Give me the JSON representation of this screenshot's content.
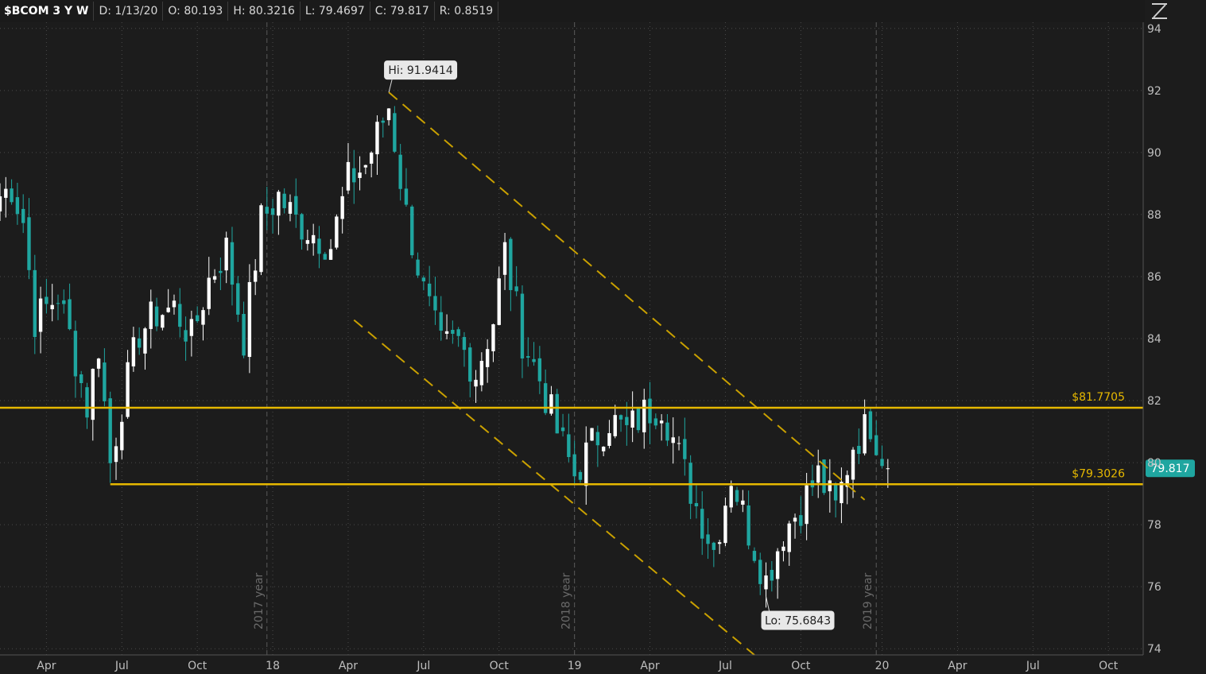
{
  "header": {
    "symbol": "$BCOM 3 Y W",
    "date": "D: 1/13/20",
    "open": "O: 80.193",
    "high": "H: 80.3216",
    "low": "L: 79.4697",
    "close": "C: 79.817",
    "range": "R: 0.8519"
  },
  "icons": {
    "alert": "alert-icon",
    "drawing": "drawing-tools-icon"
  },
  "colors": {
    "background": "#1c1c1c",
    "up_candle": "#ffffff",
    "down_candle": "#1fa6a0",
    "support_resistance": "#e6b800",
    "channel": "#c9a000",
    "grid": "#4a4a4a",
    "price_badge": "#1fa6a0"
  },
  "chart_data": {
    "type": "candlestick",
    "title": "$BCOM 3 Y W",
    "ylim": [
      73.8,
      94.2
    ],
    "y_ticks": [
      74,
      76,
      78,
      80,
      82,
      84,
      86,
      88,
      90,
      92,
      94
    ],
    "x_range": [
      "2017-02-06",
      "2020-11-16"
    ],
    "x_ticks": [
      {
        "label": "Apr",
        "date": "2017-04-03"
      },
      {
        "label": "Jul",
        "date": "2017-07-03"
      },
      {
        "label": "Oct",
        "date": "2017-10-02"
      },
      {
        "label": "18",
        "date": "2018-01-01"
      },
      {
        "label": "Apr",
        "date": "2018-04-02"
      },
      {
        "label": "Jul",
        "date": "2018-07-02"
      },
      {
        "label": "Oct",
        "date": "2018-10-01"
      },
      {
        "label": "19",
        "date": "2018-12-31"
      },
      {
        "label": "Apr",
        "date": "2019-04-01"
      },
      {
        "label": "Jul",
        "date": "2019-07-01"
      },
      {
        "label": "Oct",
        "date": "2019-09-30"
      },
      {
        "label": "20",
        "date": "2020-01-06"
      },
      {
        "label": "Apr",
        "date": "2020-04-06"
      },
      {
        "label": "Jul",
        "date": "2020-07-06"
      },
      {
        "label": "Oct",
        "date": "2020-10-05"
      }
    ],
    "year_markers": [
      {
        "label": "2017 year",
        "date": "2017-12-25"
      },
      {
        "label": "2018 year",
        "date": "2018-12-31"
      },
      {
        "label": "2019 year",
        "date": "2019-12-30"
      }
    ],
    "annotations": [
      {
        "label": "Hi: 91.9414",
        "date": "2018-05-21",
        "value": 91.9414
      },
      {
        "label": "Lo: 75.6843",
        "date": "2019-08-19",
        "value": 75.6843
      }
    ],
    "horizontal_lines": [
      {
        "label": "$81.7705",
        "value": 81.7705,
        "start": "2017-02-06"
      },
      {
        "label": "$79.3026",
        "value": 79.3026,
        "start": "2017-06-19"
      }
    ],
    "channel_lines": [
      {
        "from": {
          "date": "2018-05-21",
          "value": 91.9414
        },
        "to": {
          "date": "2019-12-16",
          "value": 78.8
        }
      },
      {
        "from": {
          "date": "2018-04-09",
          "value": 84.6
        },
        "to": {
          "date": "2019-08-05",
          "value": 73.8
        }
      }
    ],
    "last_price": {
      "label": "79.817",
      "value": 79.817
    },
    "anchors": [
      [
        "2017-02-06",
        88.6
      ],
      [
        "2017-02-20",
        88.9
      ],
      [
        "2017-03-06",
        87.8
      ],
      [
        "2017-03-20",
        84.6
      ],
      [
        "2017-04-03",
        85.0
      ],
      [
        "2017-04-17",
        85.4
      ],
      [
        "2017-05-01",
        84.1
      ],
      [
        "2017-05-22",
        81.8
      ],
      [
        "2017-06-05",
        83.8
      ],
      [
        "2017-06-19",
        80.0
      ],
      [
        "2017-07-03",
        81.9
      ],
      [
        "2017-07-24",
        84.2
      ],
      [
        "2017-08-14",
        84.8
      ],
      [
        "2017-09-04",
        85.0
      ],
      [
        "2017-09-25",
        84.0
      ],
      [
        "2017-10-16",
        85.9
      ],
      [
        "2017-11-06",
        86.9
      ],
      [
        "2017-11-27",
        84.0
      ],
      [
        "2017-12-18",
        87.8
      ],
      [
        "2018-01-08",
        88.6
      ],
      [
        "2018-01-29",
        87.8
      ],
      [
        "2018-02-19",
        87.4
      ],
      [
        "2018-03-12",
        87.0
      ],
      [
        "2018-04-02",
        89.1
      ],
      [
        "2018-04-23",
        89.6
      ],
      [
        "2018-05-21",
        91.5
      ],
      [
        "2018-06-11",
        88.0
      ],
      [
        "2018-07-02",
        85.5
      ],
      [
        "2018-07-23",
        83.7
      ],
      [
        "2018-08-13",
        83.9
      ],
      [
        "2018-09-03",
        82.9
      ],
      [
        "2018-09-24",
        84.6
      ],
      [
        "2018-10-08",
        86.8
      ],
      [
        "2018-10-29",
        84.0
      ],
      [
        "2018-11-19",
        82.7
      ],
      [
        "2018-12-10",
        81.0
      ],
      [
        "2018-12-31",
        79.6
      ],
      [
        "2019-01-21",
        80.6
      ],
      [
        "2019-02-11",
        81.4
      ],
      [
        "2019-03-04",
        81.0
      ],
      [
        "2019-03-25",
        81.6
      ],
      [
        "2019-04-15",
        81.9
      ],
      [
        "2019-05-06",
        80.2
      ],
      [
        "2019-05-27",
        78.6
      ],
      [
        "2019-06-17",
        77.2
      ],
      [
        "2019-07-08",
        79.6
      ],
      [
        "2019-07-29",
        77.8
      ],
      [
        "2019-08-19",
        76.2
      ],
      [
        "2019-09-09",
        77.8
      ],
      [
        "2019-09-30",
        78.6
      ],
      [
        "2019-10-21",
        79.6
      ],
      [
        "2019-11-11",
        78.5
      ],
      [
        "2019-12-02",
        80.6
      ],
      [
        "2019-12-23",
        81.3
      ],
      [
        "2020-01-13",
        79.8
      ]
    ]
  }
}
